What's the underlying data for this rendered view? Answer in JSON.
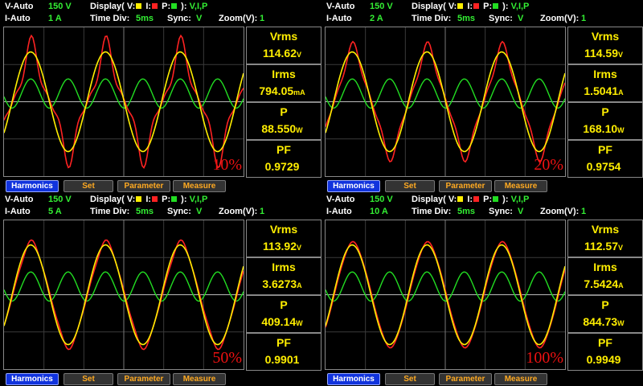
{
  "colors": {
    "voltage": "#ffee00",
    "current": "#ff2222",
    "power": "#22dd22",
    "grid": "#3a3a3a"
  },
  "labels": {
    "display_prefix": "Display( V:",
    "i": "I:",
    "p": "P:",
    "display_suffix": "):",
    "display_value": "V,I,P",
    "time_div": "Time  Div:",
    "sync": "Sync:",
    "zoom": "Zoom(V):"
  },
  "panels": [
    {
      "v_mode": "V-Auto",
      "v_range": "150 V",
      "i_mode": "I-Auto",
      "i_range": "1 A",
      "time_div": "5ms",
      "sync": "V",
      "zoom": "1",
      "percent": "10%",
      "measurements": [
        {
          "label": "Vrms",
          "value": "114.62",
          "unit": "V"
        },
        {
          "label": "Irms",
          "value": "794.05",
          "unit": "mA"
        },
        {
          "label": "P",
          "value": "88.550",
          "unit": "W"
        },
        {
          "label": "PF",
          "value": "0.9729",
          "unit": ""
        }
      ],
      "buttons": [
        "Harmonics",
        "Set",
        "Parameter",
        "Measure"
      ]
    },
    {
      "v_mode": "V-Auto",
      "v_range": "150 V",
      "i_mode": "I-Auto",
      "i_range": "2 A",
      "time_div": "5ms",
      "sync": "V",
      "zoom": "1",
      "percent": "20%",
      "measurements": [
        {
          "label": "Vrms",
          "value": "114.59",
          "unit": "V"
        },
        {
          "label": "Irms",
          "value": "1.5041",
          "unit": "A"
        },
        {
          "label": "P",
          "value": "168.10",
          "unit": "W"
        },
        {
          "label": "PF",
          "value": "0.9754",
          "unit": ""
        }
      ],
      "buttons": [
        "Harmonics",
        "Set",
        "Parameter",
        "Measure"
      ]
    },
    {
      "v_mode": "V-Auto",
      "v_range": "150 V",
      "i_mode": "I-Auto",
      "i_range": "5 A",
      "time_div": "5ms",
      "sync": "V",
      "zoom": "1",
      "percent": "50%",
      "measurements": [
        {
          "label": "Vrms",
          "value": "113.92",
          "unit": "V"
        },
        {
          "label": "Irms",
          "value": "3.6273",
          "unit": "A"
        },
        {
          "label": "P",
          "value": "409.14",
          "unit": "W"
        },
        {
          "label": "PF",
          "value": "0.9901",
          "unit": ""
        }
      ],
      "buttons": [
        "Harmonics",
        "Set",
        "Parameter",
        "Measure"
      ]
    },
    {
      "v_mode": "V-Auto",
      "v_range": "150 V",
      "i_mode": "I-Auto",
      "i_range": "10 A",
      "time_div": "5ms",
      "sync": "V",
      "zoom": "1",
      "percent": "100%",
      "measurements": [
        {
          "label": "Vrms",
          "value": "112.57",
          "unit": "V"
        },
        {
          "label": "Irms",
          "value": "7.5424",
          "unit": "A"
        },
        {
          "label": "P",
          "value": "844.73",
          "unit": "W"
        },
        {
          "label": "PF",
          "value": "0.9949",
          "unit": ""
        }
      ],
      "buttons": [
        "Harmonics",
        "Set",
        "Parameter",
        "Measure"
      ]
    }
  ]
}
